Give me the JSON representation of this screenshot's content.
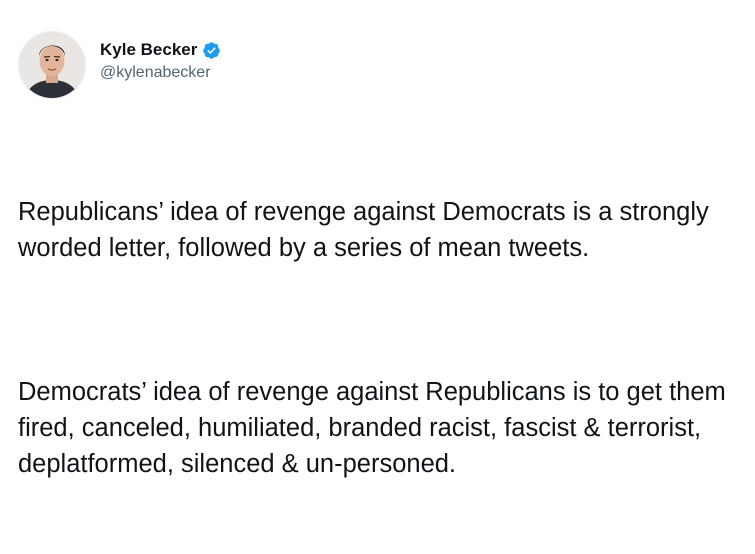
{
  "author": {
    "display_name": "Kyle Becker",
    "handle": "@kylenabecker",
    "verified": true,
    "avatar_icon": "profile-photo",
    "verified_icon": "verified-badge-icon",
    "verified_color": "#1d9bf0"
  },
  "tweet": {
    "paragraphs": [
      "Republicans’ idea of revenge against Democrats is a strongly worded letter, followed by a series of mean tweets.",
      "Democrats’ idea of revenge against Republicans is to get them fired, canceled, humiliated, branded racist, fascist & terrorist, deplatformed, silenced & un-personed."
    ]
  }
}
